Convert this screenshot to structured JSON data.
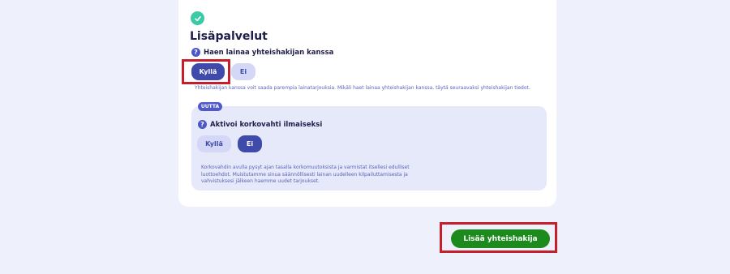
{
  "section": {
    "title": "Lisäpalvelut"
  },
  "question1": {
    "icon_glyph": "?",
    "label": "Haen lainaa yhteishakijan kanssa",
    "yes_label": "Kyllä",
    "no_label": "Ei",
    "selected": "yes",
    "helper": "Yhteishakijan kanssa voit saada parempia lainatarjouksia. Mikäli haet lainaa yhteishakijan kanssa, täytä seuraavaksi yhteishakijan tiedot."
  },
  "question2": {
    "badge": "UUTTA",
    "icon_glyph": "?",
    "label": "Aktivoi korkovahti ilmaiseksi",
    "yes_label": "Kyllä",
    "no_label": "Ei",
    "selected": "no",
    "description": "Korkovahdin avulla pysyt ajan tasalla korkomuutoksista ja varmistat itsellesi edulliset luottoehdot. Muistutamme sinua säännöllisesti lainan uudelleen kilpailuttamisesta ja vahvistuksesi jälkeen haemme uudet tarjoukset."
  },
  "actions": {
    "add_coapplicant_label": "Lisää yhteishakija"
  },
  "colors": {
    "accent": "#3f4aaa",
    "success": "#1c8a1c",
    "check": "#3bc9a6",
    "highlight": "#c61f2b"
  }
}
